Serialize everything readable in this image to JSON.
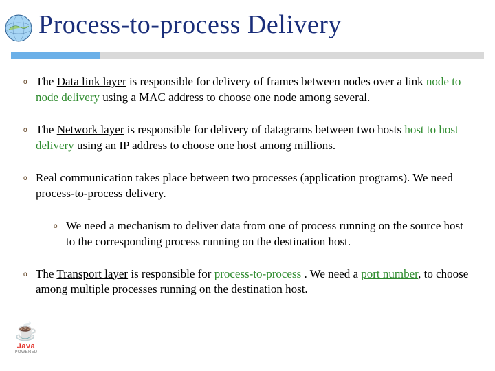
{
  "title": "Process-to-process Delivery",
  "bullets": {
    "b1": {
      "pre": "The ",
      "dl": "Data link layer",
      "mid1": " is responsible for delivery of frames between nodes over a link ",
      "n2n": "node to node delivery",
      "mid2": " using a ",
      "mac": "MAC",
      "post": " address to choose one node among several."
    },
    "b2": {
      "pre": "The ",
      "nl": "Network layer",
      "mid1": " is responsible for delivery of datagrams between two hosts ",
      "h2h": "host to host delivery",
      "mid2": " using an ",
      "ip": "IP",
      "post": " address to choose one host among millions."
    },
    "b3": {
      "text": "Real communication takes place between two processes (application programs). We need process-to-process delivery."
    },
    "b3a": {
      "text": "We need a mechanism to deliver data from one of process running on the source host to the corresponding process running on the destination host."
    },
    "b4": {
      "pre": "The ",
      "tl": "Transport layer",
      "mid1": " is responsible for ",
      "p2p": "process-to-process",
      "mid2": " . We need a ",
      "port": "port number",
      "post": ", to choose among multiple processes running on the destination host."
    }
  },
  "marker": "o",
  "java": {
    "word": "Java",
    "sub": "POWERED"
  }
}
